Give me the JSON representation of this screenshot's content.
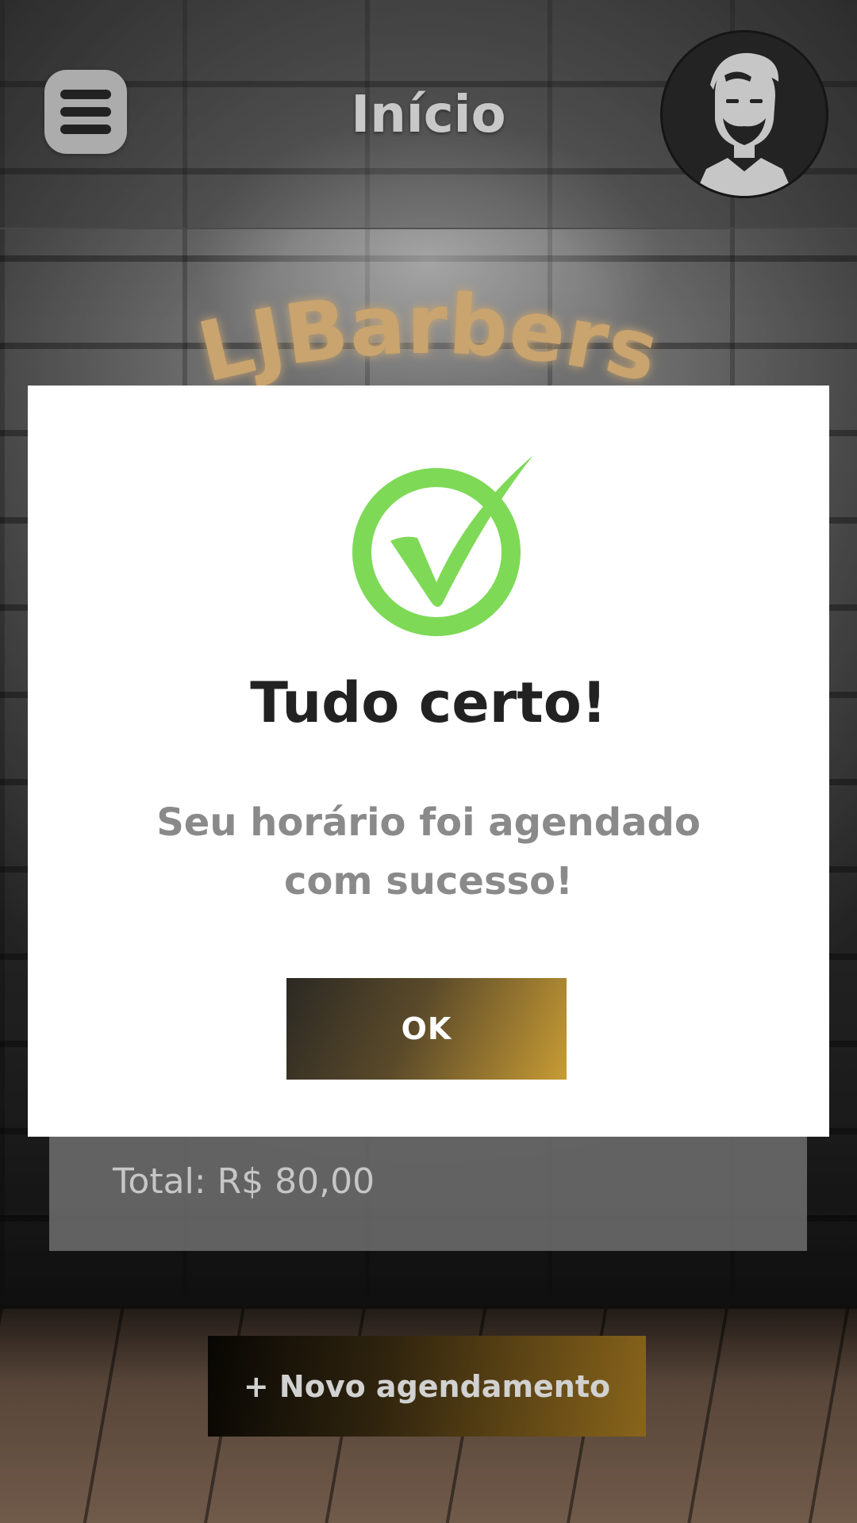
{
  "header": {
    "title": "Início",
    "menu_icon": "hamburger-menu-icon",
    "avatar_icon": "bearded-man-avatar-icon"
  },
  "brand": {
    "name": "LJBarbers"
  },
  "summary": {
    "total": "Total: R$ 80,00"
  },
  "actions": {
    "new_booking_label": "+ Novo agendamento"
  },
  "modal": {
    "icon": "success-check-icon",
    "title": "Tudo certo!",
    "message_line1": "Seu horário foi agendado",
    "message_line2": "com sucesso!",
    "ok_label": "OK"
  },
  "colors": {
    "success_green": "#7ed957",
    "gold_accent": "#c89c34",
    "modal_bg": "#ffffff"
  }
}
